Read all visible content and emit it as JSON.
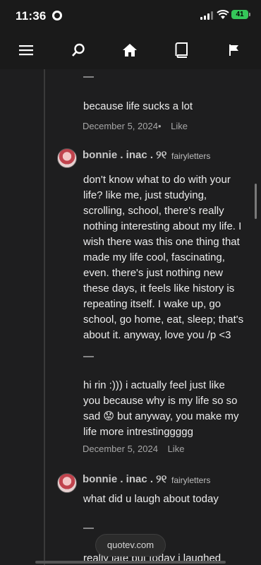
{
  "status": {
    "time": "11:36",
    "battery": "41"
  },
  "nav": {
    "items": [
      "menu-icon",
      "search-icon",
      "home-icon",
      "book-icon",
      "flag-icon"
    ]
  },
  "comments": [
    {
      "text_top": "—",
      "text_main": "because life sucks a lot",
      "date": "December 5, 2024",
      "dot": "•",
      "like": "Like"
    },
    {
      "username": "bonnie . inac . ୨୧",
      "handle": "fairyletters",
      "lines": [
        "don't know what to do with your",
        "life? like me, just studying,",
        "scrolling, school, there's really",
        "nothing interesting about my life. I",
        "wish there was this one thing that",
        "made my life cool, fascinating,",
        "even. there's just nothing new",
        "these days, it feels like history is",
        "repeating itself. I wake up, go",
        "school, go home, eat, sleep; that's",
        "about it. anyway, love you /p <3"
      ],
      "divider": "—",
      "reply_lines": [
        "hi rin :))) i actually feel just like",
        "you because why is my life so so",
        "sad 😟 but anyway, you make my",
        "life more intrestinggggg"
      ],
      "date": "December 5, 2024",
      "like": "Like"
    },
    {
      "username": "bonnie . inac . ୨୧",
      "handle": "fairyletters",
      "text": "what did u laugh about today",
      "divider": "—",
      "reply_partial": "really late but today i laughed"
    }
  ],
  "footer_pill": "quotev.com"
}
